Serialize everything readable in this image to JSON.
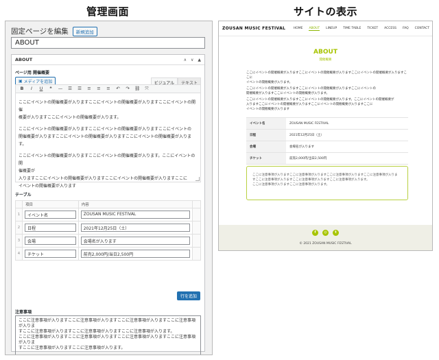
{
  "headings": {
    "admin": "管理画面",
    "site": "サイトの表示"
  },
  "admin": {
    "title": "固定ページを編集",
    "new_button": "新規追加",
    "title_value": "ABOUT",
    "metabox_title": "ABOUT",
    "controls": [
      "∧",
      "∨",
      "▲"
    ],
    "summary_label": "ページ用 開催概要",
    "media_button": "メディアを追加",
    "tabs": {
      "visual": "ビジュアル",
      "text": "テキスト"
    },
    "toolbar_icons": [
      "B",
      "I",
      "U",
      "❝",
      "—",
      "☰",
      "☰",
      "≡",
      "≡",
      "≡",
      "↶",
      "↷",
      "⛓",
      "⤧"
    ],
    "editor_paragraphs": [
      "ここにイベントの開催概要が入りますここにイベントの開催概要が入りますここにイベントの開催\n概要が入りますここにイベントの開催概要が入ります。",
      "ここにイベントの開催概要が入りますここにイベントの開催概要が入りますここにイベントの\n開催概要が入りますここにイベントの開催概要が入りますここにイベントの開催概要が入ります。",
      "ここにイベントの開催概要が入りますここにイベントの開催概要が入ります。ここにイベントの開\n催概要が\n入りますここにイベントの開催概要が入りますここにイベントの開催概要が入りますここに\nイベントの開催概要が入ります"
    ],
    "table_label": "テーブル",
    "table_headers": [
      "項目",
      "内容"
    ],
    "table_rows": [
      {
        "num": "1",
        "key": "イベント名",
        "value": "ZOUSAN MUSIC FESTIVAL"
      },
      {
        "num": "2",
        "key": "日程",
        "value": "2021年12月25日（土）"
      },
      {
        "num": "3",
        "key": "会場",
        "value": "会場名が入ります"
      },
      {
        "num": "4",
        "key": "チケット",
        "value": "前売2,000円/当日2,500円"
      }
    ],
    "add_row_button": "行を追加",
    "notice_label": "注意事項",
    "notice_text": "ここに注意事項が入りますここに注意事項が入りますここに注意事項が入りますここに注意事項が入りま\nすここに注意事項が入りますここに注意事項が入りますここに注意事項が入ります。\nここに注意事項が入りますここに注意事項が入りますここに注意事項が入りますここに注意事項が入りま\nすここに注意事項が入りますここに注意事項が入ります。"
  },
  "site": {
    "logo": "ZOUSAN MUSIC FESTIVAL",
    "nav": [
      "HOME",
      "ABOUT",
      "LINEUP",
      "TIME TABLE",
      "TICKET",
      "ACCESS",
      "FAQ",
      "CONTACT"
    ],
    "nav_current": "ABOUT",
    "title": "ABOUT",
    "subtitle": "開催概要",
    "intro_paragraphs": [
      "ここにイベントの開催概要が入りますここにイベントの開催概要が入りますここにイベントの開催概要が入りますここに\nイベントの開催概要が入ります。",
      "ここにイベントの開催概要が入りますここにイベントの開催概要が入りますここにイベントの\n開催概要が入りますここにイベントの開催概要が入ります。",
      "ここにイベントの開催概要が入りますここにイベントの開催概要が入ります。ここにイベントの開催概要が\n入りますここにイベントの開催概要が入りますここにイベントの開催概要が入りますここに\nイベントの開催概要が入ります"
    ],
    "table_rows": [
      {
        "key": "イベント名",
        "value": "ZOUSAN MUSIC FESTIVAL"
      },
      {
        "key": "日程",
        "value": "2021年12月25日（土）"
      },
      {
        "key": "会場",
        "value": "会場名が入ります"
      },
      {
        "key": "チケット",
        "value": "前売2,000円/当日2,500円"
      }
    ],
    "notice_text": "ここに注意事項が入りますここに注意事項が入りますここに注意事項が入りますここに注意事項が入りま\nすここに注意事項が入りますここに注意事項が入りますここに注意事項が入ります。\nここに注意事項が入りますここに注意事項が入ります。",
    "sns_icons": [
      "f",
      "◎",
      "t"
    ],
    "copyright": "© 2021 ZOUSAN MUSIC FESTIVAL"
  },
  "colors": {
    "accent": "#a7c400",
    "wp_blue": "#2271b1"
  }
}
